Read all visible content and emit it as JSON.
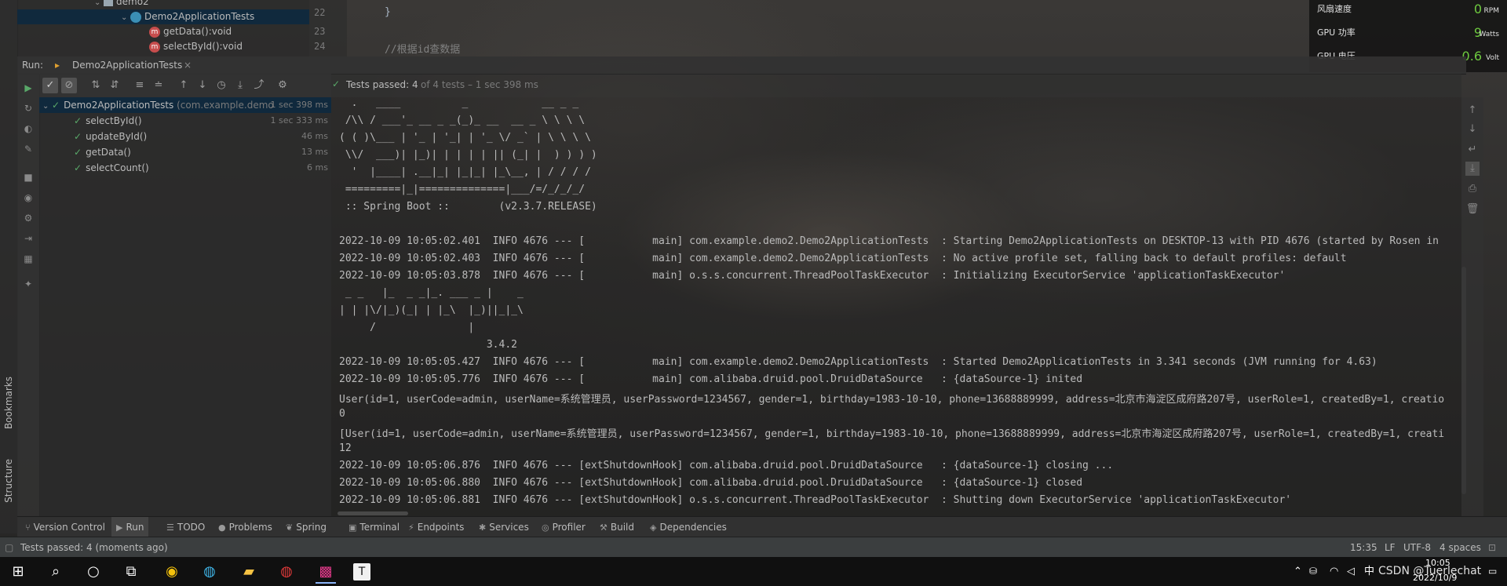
{
  "project_tree": {
    "items": [
      {
        "label": "demo2",
        "type": "folder"
      },
      {
        "label": "Demo2ApplicationTests",
        "type": "class"
      },
      {
        "label": "getData():void",
        "type": "method"
      },
      {
        "label": "selectById():void",
        "type": "method"
      }
    ]
  },
  "editor": {
    "line_numbers": [
      "22",
      "23",
      "24"
    ],
    "lines": [
      "}",
      "",
      "//根据id查数据"
    ]
  },
  "gpu_overlay": {
    "rows": [
      {
        "label": "风扇速度",
        "value": "0",
        "unit": "RPM"
      },
      {
        "label": "GPU 功率",
        "value": "9",
        "unit": "Watts"
      },
      {
        "label": "GPU 电压",
        "value": "0.6",
        "unit": "Volt"
      }
    ],
    "accent": "#6ecb3f"
  },
  "run_bar": {
    "label": "Run:",
    "tab": "Demo2ApplicationTests",
    "close": "×"
  },
  "test_status": {
    "passed_label": "Tests passed:",
    "passed_count": "4",
    "detail": "of 4 tests – 1 sec 398 ms"
  },
  "tests": {
    "root": {
      "name": "Demo2ApplicationTests",
      "pkg": "(com.example.demo",
      "time": "1 sec 398 ms"
    },
    "items": [
      {
        "name": "selectById()",
        "time": "1 sec 333 ms"
      },
      {
        "name": "updateById()",
        "time": "46 ms"
      },
      {
        "name": "getData()",
        "time": "13 ms"
      },
      {
        "name": "selectCount()",
        "time": "6 ms"
      }
    ]
  },
  "console": {
    "lines": [
      "  .   ____          _            __ _ _",
      " /\\\\ / ___'_ __ _ _(_)_ __  __ _ \\ \\ \\ \\",
      "( ( )\\___ | '_ | '_| | '_ \\/ _` | \\ \\ \\ \\",
      " \\\\/  ___)| |_)| | | | | || (_| |  ) ) ) )",
      "  '  |____| .__|_| |_|_| |_\\__, | / / / /",
      " =========|_|==============|___/=/_/_/_/",
      " :: Spring Boot ::        (v2.3.7.RELEASE)",
      "",
      "2022-10-09 10:05:02.401  INFO 4676 --- [           main] com.example.demo2.Demo2ApplicationTests  : Starting Demo2ApplicationTests on DESKTOP-13 with PID 4676 (started by Rosen in",
      "2022-10-09 10:05:02.403  INFO 4676 --- [           main] com.example.demo2.Demo2ApplicationTests  : No active profile set, falling back to default profiles: default",
      "2022-10-09 10:05:03.878  INFO 4676 --- [           main] o.s.s.concurrent.ThreadPoolTaskExecutor  : Initializing ExecutorService 'applicationTaskExecutor'",
      " _ _   |_  _ _|_. ___ _ |    _",
      "| | |\\/|_)(_| | |_\\  |_)||_|_\\",
      "     /               |",
      "                        3.4.2",
      "2022-10-09 10:05:05.427  INFO 4676 --- [           main] com.example.demo2.Demo2ApplicationTests  : Started Demo2ApplicationTests in 3.341 seconds (JVM running for 4.63)",
      "2022-10-09 10:05:05.776  INFO 4676 --- [           main] com.alibaba.druid.pool.DruidDataSource   : {dataSource-1} inited",
      "User(id=1, userCode=admin, userName=系统管理员, userPassword=1234567, gender=1, birthday=1983-10-10, phone=13688889999, address=北京市海淀区成府路207号, userRole=1, createdBy=1, creatio",
      "0",
      "[User(id=1, userCode=admin, userName=系统管理员, userPassword=1234567, gender=1, birthday=1983-10-10, phone=13688889999, address=北京市海淀区成府路207号, userRole=1, createdBy=1, creati",
      "12",
      "2022-10-09 10:05:06.876  INFO 4676 --- [extShutdownHook] com.alibaba.druid.pool.DruidDataSource   : {dataSource-1} closing ...",
      "2022-10-09 10:05:06.880  INFO 4676 --- [extShutdownHook] com.alibaba.druid.pool.DruidDataSource   : {dataSource-1} closed",
      "2022-10-09 10:05:06.881  INFO 4676 --- [extShutdownHook] o.s.s.concurrent.ThreadPoolTaskExecutor  : Shutting down ExecutorService 'applicationTaskExecutor'"
    ]
  },
  "side_labels": {
    "bookmarks": "Bookmarks",
    "structure": "Structure"
  },
  "tool_windows": [
    {
      "label": "Version Control",
      "icon": "version-control-icon"
    },
    {
      "label": "Run",
      "icon": "run-icon"
    },
    {
      "label": "TODO",
      "icon": "todo-icon"
    },
    {
      "label": "Problems",
      "icon": "problems-icon"
    },
    {
      "label": "Spring",
      "icon": "spring-icon"
    },
    {
      "label": "Terminal",
      "icon": "terminal-icon"
    },
    {
      "label": "Endpoints",
      "icon": "endpoints-icon"
    },
    {
      "label": "Services",
      "icon": "services-icon"
    },
    {
      "label": "Profiler",
      "icon": "profiler-icon"
    },
    {
      "label": "Build",
      "icon": "build-icon"
    },
    {
      "label": "Dependencies",
      "icon": "dependencies-icon"
    }
  ],
  "status_bar": {
    "message": "Tests passed: 4 (moments ago)",
    "position": "15:35",
    "line_sep": "LF",
    "encoding": "UTF-8",
    "indent": "4 spaces"
  },
  "taskbar": {
    "time": "10:05",
    "date": "2022/10/9",
    "ime": "中",
    "watermark": "CSDN @Tuerlechat"
  }
}
